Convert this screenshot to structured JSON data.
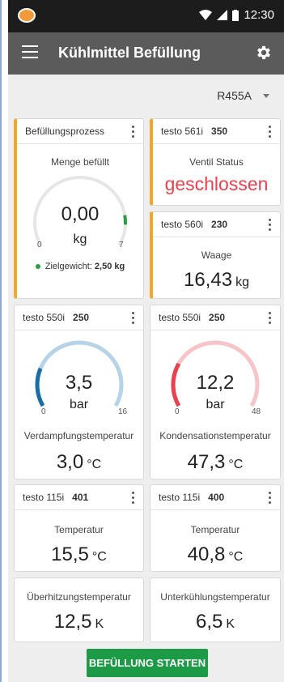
{
  "statusbar": {
    "time": "12:30"
  },
  "appbar": {
    "title": "Kühlmittel Befüllung"
  },
  "refrigerant": {
    "selected": "R455A"
  },
  "cards": {
    "process": {
      "header": "Befüllungsprozess",
      "label": "Menge befüllt",
      "value": "0,00",
      "unit": "kg",
      "gauge_min": "0",
      "gauge_max": "7",
      "target_label": "Zielgewicht:",
      "target_value": "2,50 kg",
      "gauge_fraction": 0.06
    },
    "valve": {
      "device": "testo 561i",
      "serial": "350",
      "label": "Ventil Status",
      "status": "geschlossen"
    },
    "scale": {
      "device": "testo 560i",
      "serial": "230",
      "label": "Waage",
      "value": "16,43",
      "unit": "kg"
    },
    "low_pressure": {
      "device": "testo 550i",
      "serial": "250",
      "value": "3,5",
      "unit": "bar",
      "gauge_min": "0",
      "gauge_max": "16",
      "label": "Verdampfungstemperatur",
      "temp": "3,0",
      "temp_unit": "°C",
      "gauge_fraction": 0.22,
      "color": "#1a6ea8",
      "track_color": "#b7d3e8"
    },
    "high_pressure": {
      "device": "testo 550i",
      "serial": "250",
      "value": "12,2",
      "unit": "bar",
      "gauge_min": "0",
      "gauge_max": "48",
      "label": "Kondensationstemperatur",
      "temp": "47,3",
      "temp_unit": "°C",
      "gauge_fraction": 0.25,
      "color": "#e8414f",
      "track_color": "#f7c4c9"
    },
    "temp1": {
      "device": "testo 115i",
      "serial": "401",
      "label": "Temperatur",
      "value": "15,5",
      "unit": "°C"
    },
    "temp2": {
      "device": "testo 115i",
      "serial": "400",
      "label": "Temperatur",
      "value": "40,8",
      "unit": "°C"
    },
    "superheat": {
      "label": "Überhitzungstemperatur",
      "value": "12,5",
      "unit": "K"
    },
    "subcool": {
      "label": "Unterkühlungstemperatur",
      "value": "6,5",
      "unit": "K"
    }
  },
  "actions": {
    "start_label": "BEFÜLLUNG STARTEN"
  },
  "colors": {
    "accent": "#f5a623",
    "primary": "#1c9a45",
    "closed": "#e8414f",
    "appbar": "#5b5b5b"
  }
}
